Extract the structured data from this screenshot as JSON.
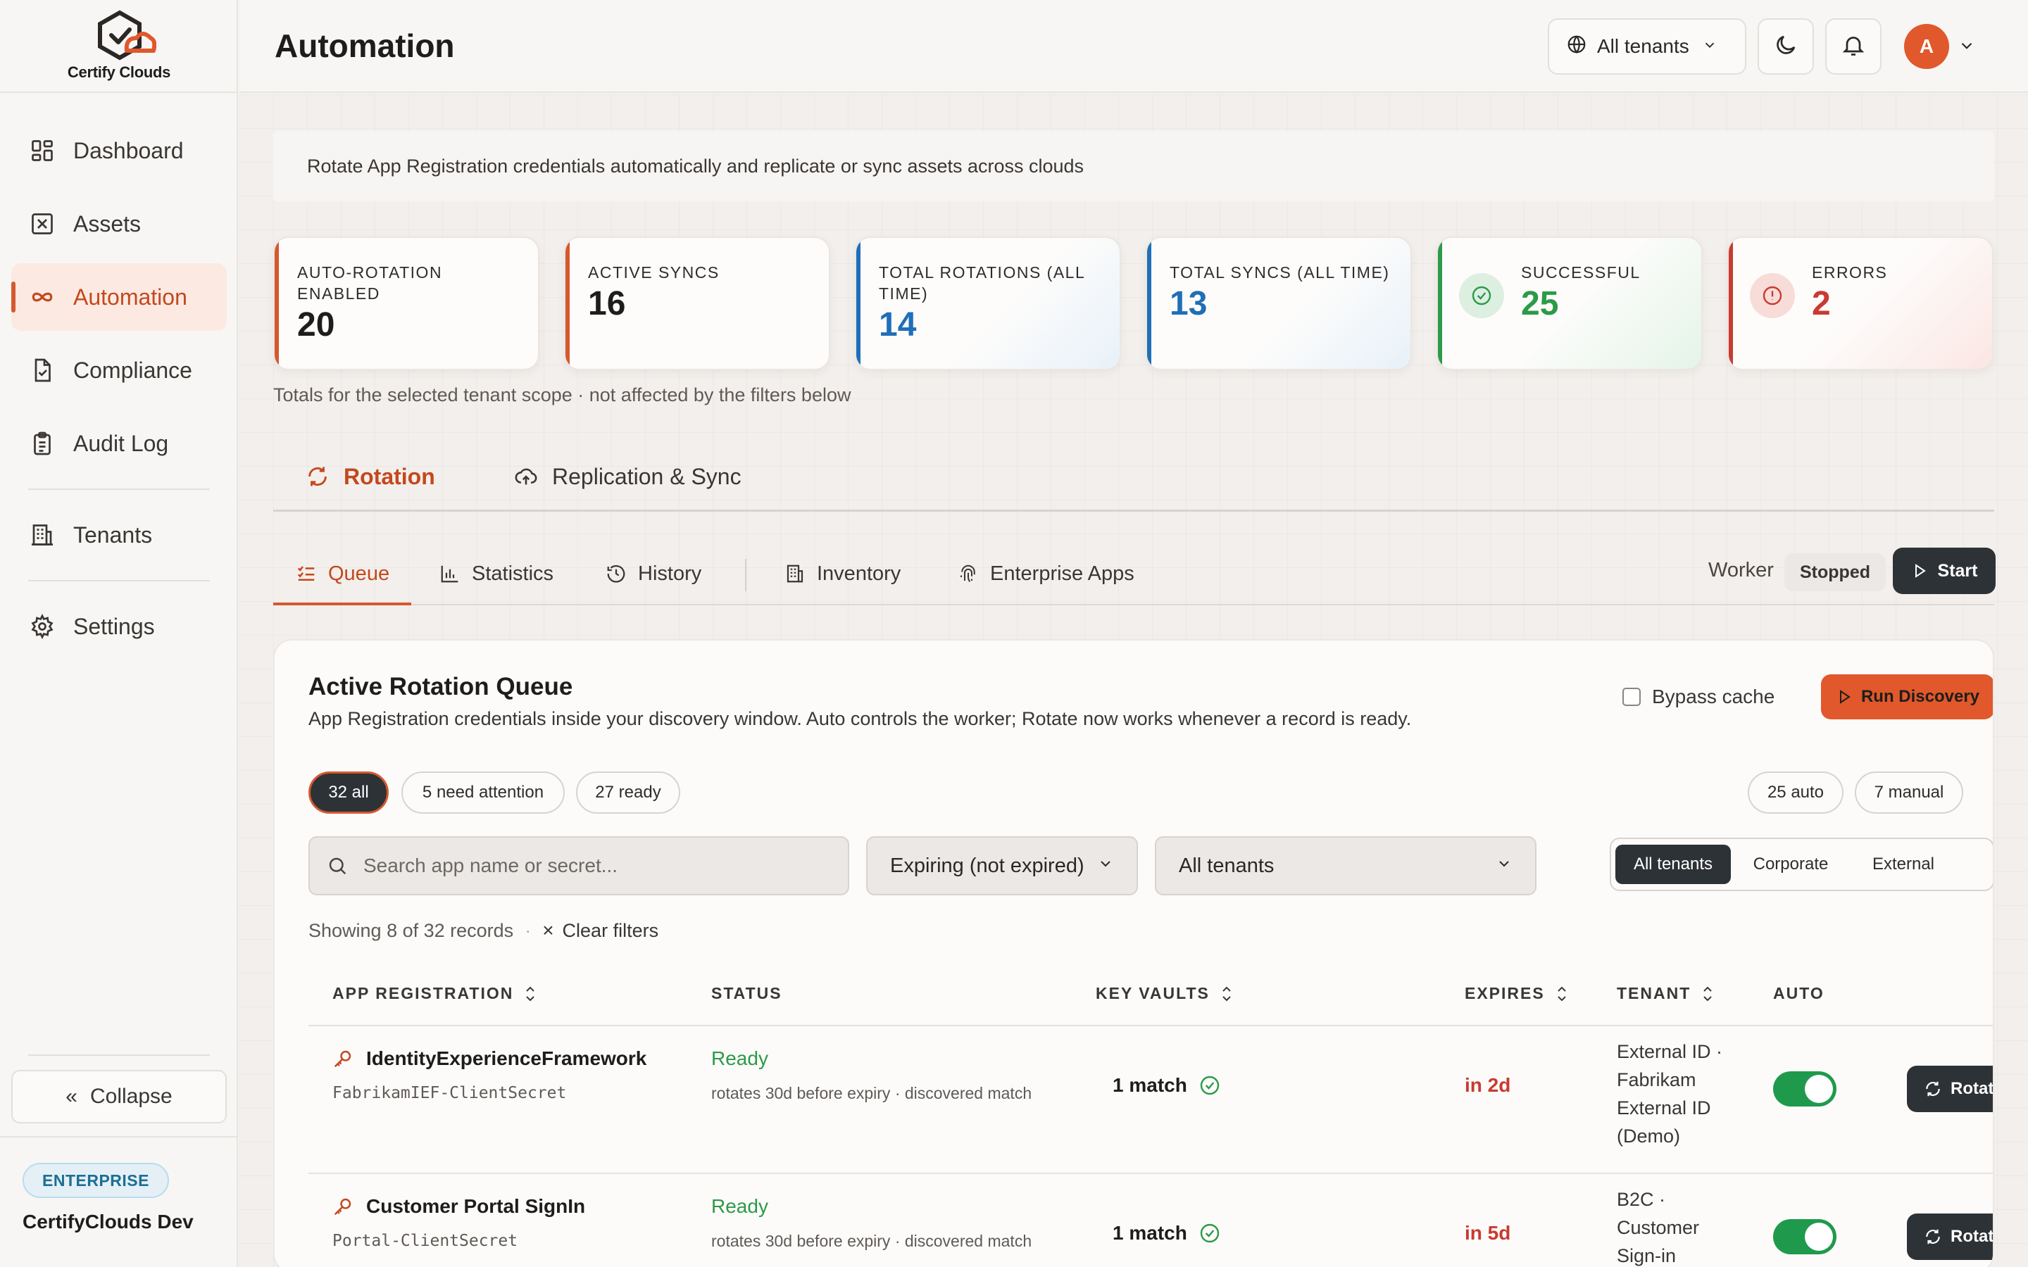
{
  "brand": {
    "name": "Certify Clouds",
    "accent": "#e0582b"
  },
  "sidebar": {
    "items": [
      {
        "label": "Dashboard",
        "icon": "dashboard-icon"
      },
      {
        "label": "Assets",
        "icon": "assets-icon"
      },
      {
        "label": "Automation",
        "icon": "infinity-icon",
        "active": true
      },
      {
        "label": "Compliance",
        "icon": "file-check-icon"
      },
      {
        "label": "Audit Log",
        "icon": "clipboard-icon"
      },
      {
        "label": "Tenants",
        "icon": "building-icon"
      },
      {
        "label": "Settings",
        "icon": "gear-icon"
      }
    ],
    "collapse_label": "Collapse",
    "plan_badge": "ENTERPRISE",
    "org_name": "CertifyClouds Dev"
  },
  "header": {
    "title": "Automation",
    "tenant_select": "All tenants",
    "avatar_initial": "A"
  },
  "intro": "Rotate App Registration credentials automatically and replicate or sync assets across clouds",
  "stats": [
    {
      "label": "AUTO-ROTATION ENABLED",
      "value": "20",
      "color": "#d4592e"
    },
    {
      "label": "ACTIVE SYNCS",
      "value": "16",
      "color": "#d4592e"
    },
    {
      "label": "TOTAL ROTATIONS (ALL TIME)",
      "value": "14",
      "color": "#1f6fb8"
    },
    {
      "label": "TOTAL SYNCS (ALL TIME)",
      "value": "13",
      "color": "#1f6fb8"
    },
    {
      "label": "SUCCESSFUL",
      "value": "25",
      "color": "#2c9a48"
    },
    {
      "label": "ERRORS",
      "value": "2",
      "color": "#c93a30"
    }
  ],
  "stats_note": "Totals for the selected tenant scope · not affected by the filters below",
  "main_tabs": [
    {
      "label": "Rotation",
      "active": true
    },
    {
      "label": "Replication & Sync"
    }
  ],
  "sub_tabs": [
    {
      "label": "Queue",
      "active": true
    },
    {
      "label": "Statistics"
    },
    {
      "label": "History"
    },
    {
      "label": "Inventory"
    },
    {
      "label": "Enterprise Apps"
    }
  ],
  "worker": {
    "label": "Worker",
    "status": "Stopped",
    "start_label": "Start"
  },
  "queue": {
    "title": "Active Rotation Queue",
    "subtitle": "App Registration credentials inside your discovery window. Auto controls the worker; Rotate now works whenever a record is ready.",
    "bypass_label": "Bypass cache",
    "run_label": "Run Discovery",
    "chips": [
      "32 all",
      "5 need attention",
      "27 ready"
    ],
    "mode_chips": [
      "25 auto",
      "7 manual"
    ],
    "search_placeholder": "Search app name or secret...",
    "expiry_filter": "Expiring (not expired)",
    "tenant_filter": "All tenants",
    "segments": [
      "All tenants",
      "Corporate",
      "External"
    ],
    "showing": "Showing 8 of 32 records",
    "clear_label": "Clear filters",
    "columns": [
      "APP REGISTRATION",
      "STATUS",
      "KEY VAULTS",
      "EXPIRES",
      "TENANT",
      "AUTO"
    ],
    "rows": [
      {
        "name": "IdentityExperienceFramework",
        "secret": "FabrikamIEF-ClientSecret",
        "status": "Ready",
        "status_detail": "rotates 30d before expiry · discovered match",
        "key_vaults": "1 match",
        "expires": "in 2d",
        "tenant": "External ID · Fabrikam External ID (Demo)",
        "auto": true,
        "action": "Rotate now"
      },
      {
        "name": "Customer Portal SignIn",
        "secret": "Portal-ClientSecret",
        "status": "Ready",
        "status_detail": "rotates 30d before expiry · discovered match",
        "key_vaults": "1 match",
        "expires": "in 5d",
        "tenant": "B2C · Customer Sign-in",
        "auto": true,
        "action": "Rotate now"
      }
    ]
  }
}
